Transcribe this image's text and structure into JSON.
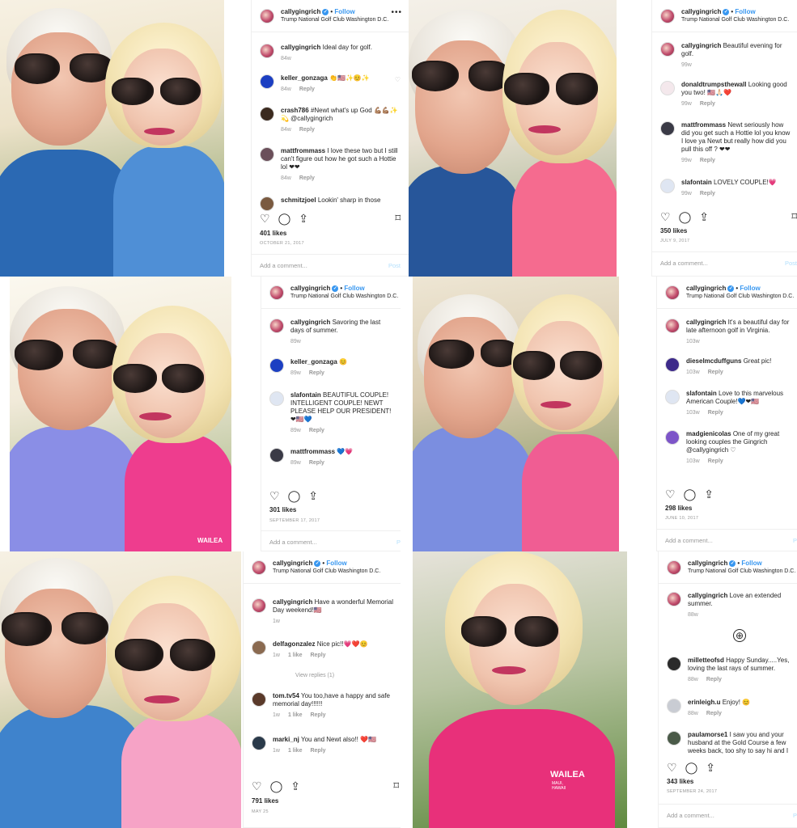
{
  "posts": [
    {
      "username": "callygingrich",
      "verified_mark": "✓",
      "follow_label": "Follow",
      "location": "Trump National Golf Club Washington D.C.",
      "more_icon": "•••",
      "caption": "Ideal day for golf.",
      "caption_age": "84w",
      "comments": [
        {
          "user": "keller_gonzaga",
          "text": "👏🇺🇸✨😊✨",
          "age": "84w",
          "reply": "Reply"
        },
        {
          "user": "crash786",
          "text": "#Newt what's up God 💪🏽💪🏽✨💫 @callygingrich",
          "age": "84w",
          "reply": "Reply"
        },
        {
          "user": "mattfrommass",
          "text": "I love these two but I still can't figure out how he got such a Hottie lol ❤❤",
          "age": "84w",
          "reply": "Reply"
        },
        {
          "user": "schmitzjoel",
          "text": "Lookin' sharp in those"
        }
      ],
      "likes": "401 likes",
      "date": "OCTOBER 21, 2017",
      "add_comment": "Add a comment...",
      "post_label": "Post"
    },
    {
      "username": "callygingrich",
      "verified_mark": "✓",
      "follow_label": "Follow",
      "location": "Trump National Golf Club Washington D.C.",
      "more_icon": "•••",
      "caption": "Beautiful evening for golf.",
      "caption_age": "99w",
      "comments": [
        {
          "user": "donaldtrumpsthewall",
          "text": "Looking good you two! 🇺🇸🙏🏻❤️",
          "age": "99w",
          "reply": "Reply"
        },
        {
          "user": "mattfrommass",
          "text": "Newt seriously how did you get such a Hottie lol you know I love ya Newt but really how did you pull this off ? ❤❤",
          "age": "99w",
          "reply": "Reply"
        },
        {
          "user": "slafontain",
          "text": "LOVELY COUPLE!💗",
          "age": "99w",
          "reply": "Reply"
        }
      ],
      "likes": "350 likes",
      "date": "JULY 9, 2017",
      "add_comment": "Add a comment...",
      "post_label": "Post"
    },
    {
      "username": "callygingrich",
      "verified_mark": "✓",
      "follow_label": "Follow",
      "location": "Trump National Golf Club Washington D.C.",
      "more_icon": "•••",
      "caption": "Savoring the last days of summer.",
      "caption_age": "89w",
      "comments": [
        {
          "user": "keller_gonzaga",
          "text": "😊",
          "age": "89w",
          "reply": "Reply"
        },
        {
          "user": "slafontain",
          "text": "BEAUTIFUL COUPLE! INTELLIGENT COUPLE! NEWT PLEASE HELP OUR PRESIDENT!❤🇺🇸💙",
          "age": "89w",
          "reply": "Reply"
        },
        {
          "user": "mattfrommass",
          "text": "💙💗",
          "age": "89w",
          "reply": "Reply"
        }
      ],
      "likes": "301 likes",
      "date": "SEPTEMBER 17, 2017",
      "add_comment": "Add a comment...",
      "post_label": "P"
    },
    {
      "username": "callygingrich",
      "verified_mark": "✓",
      "follow_label": "Follow",
      "location": "Trump National Golf Club Washington D.C.",
      "more_icon": "",
      "caption": "It's a beautiful day for late afternoon golf in Virginia.",
      "caption_age": "103w",
      "comments": [
        {
          "user": "dieselmcduffguns",
          "text": "Great pic!",
          "age": "103w",
          "reply": "Reply"
        },
        {
          "user": "slafontain",
          "text": "Love to this marvelous American Couple!💙❤🇺🇸",
          "age": "103w",
          "reply": "Reply"
        },
        {
          "user": "madgienicolas",
          "text": "One of my great looking couples the Gingrich @callygingrich ♡",
          "age": "103w",
          "reply": "Reply"
        }
      ],
      "likes": "298 likes",
      "date": "JUNE 10, 2017",
      "add_comment": "Add a comment...",
      "post_label": "P"
    },
    {
      "username": "callygingrich",
      "verified_mark": "✓",
      "follow_label": "Follow",
      "location": "Trump National Golf Club Washington D.C.",
      "more_icon": "",
      "caption": "Have a wonderful Memorial Day weekend!🇺🇸",
      "caption_age": "1w",
      "comments": [
        {
          "user": "delfagonzalez",
          "text": "Nice pic!!💗❤️😊",
          "age": "1w",
          "like_count": "1 like",
          "reply": "Reply",
          "view_replies": "View replies (1)"
        },
        {
          "user": "tom.tv54",
          "text": "You too,have a happy and safe memorial day!!!!!!",
          "age": "1w",
          "like_count": "1 like",
          "reply": "Reply"
        },
        {
          "user": "marki_nj",
          "text": "You and Newt also!! ❤️🇺🇸",
          "age": "1w",
          "like_count": "1 like",
          "reply": "Reply"
        }
      ],
      "likes": "791 likes",
      "date": "MAY 25",
      "add_comment": "",
      "post_label": ""
    },
    {
      "username": "callygingrich",
      "verified_mark": "✓",
      "follow_label": "Follow",
      "location": "Trump National Golf Club Washington D.C.",
      "more_icon": "",
      "caption": "Love an extended summer.",
      "caption_age": "88w",
      "load_more_icon": "⊕",
      "comments": [
        {
          "user": "milletteofsd",
          "text": "Happy Sunday.....Yes, loving the last rays of summer.",
          "age": "88w",
          "reply": "Reply"
        },
        {
          "user": "erinleigh.u",
          "text": "Enjoy! 😊",
          "age": "88w",
          "reply": "Reply"
        },
        {
          "user": "paulamorse1",
          "text": "I saw you and your husband at the Gold Course a few weeks back, too shy to say hi and I"
        }
      ],
      "likes": "343 likes",
      "date": "SEPTEMBER 24, 2017",
      "add_comment": "Add a comment...",
      "post_label": "P"
    }
  ],
  "icons": {
    "heart": "♡",
    "comment": "◯",
    "share": "⇪",
    "bookmark": "⌑"
  },
  "shirt_text": {
    "brand": "WAILEA",
    "sub": "MAUI, HAWAII"
  },
  "colors": {
    "link_blue": "#3897f0",
    "muted": "#999999",
    "pink_shirt": "#f0527f",
    "blue_shirt": "#2f6bb8"
  }
}
